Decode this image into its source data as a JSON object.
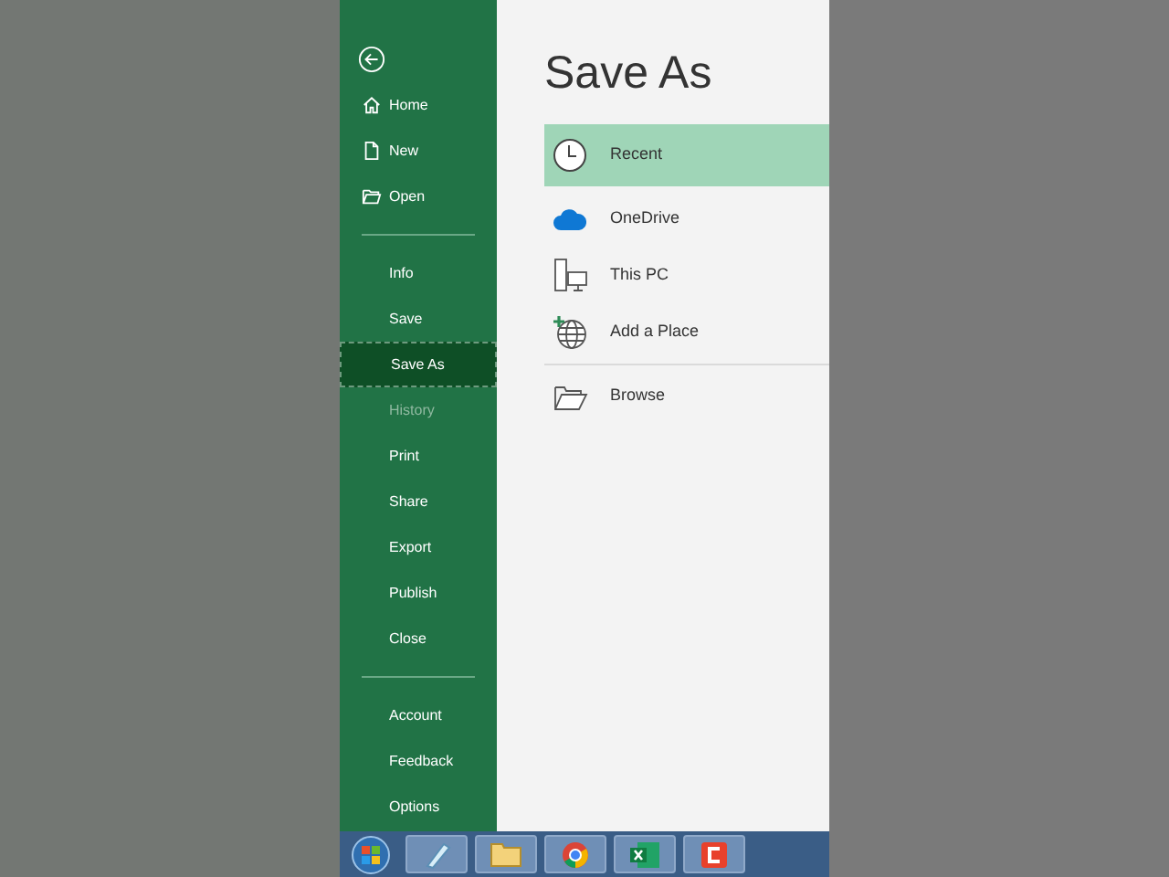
{
  "sidebar": {
    "groups": [
      {
        "items": [
          {
            "label": "Home",
            "selected": false,
            "disabled": false
          },
          {
            "label": "New",
            "selected": false,
            "disabled": false
          },
          {
            "label": "Open",
            "selected": false,
            "disabled": false
          }
        ]
      },
      {
        "items": [
          {
            "label": "Info",
            "selected": false,
            "disabled": false
          },
          {
            "label": "Save",
            "selected": false,
            "disabled": false
          },
          {
            "label": "Save As",
            "selected": true,
            "disabled": false
          },
          {
            "label": "History",
            "selected": false,
            "disabled": true
          },
          {
            "label": "Print",
            "selected": false,
            "disabled": false
          },
          {
            "label": "Share",
            "selected": false,
            "disabled": false
          },
          {
            "label": "Export",
            "selected": false,
            "disabled": false
          },
          {
            "label": "Publish",
            "selected": false,
            "disabled": false
          },
          {
            "label": "Close",
            "selected": false,
            "disabled": false
          }
        ]
      },
      {
        "items": [
          {
            "label": "Account",
            "selected": false,
            "disabled": false
          },
          {
            "label": "Feedback",
            "selected": false,
            "disabled": false
          },
          {
            "label": "Options",
            "selected": false,
            "disabled": false
          }
        ]
      }
    ]
  },
  "main": {
    "title": "Save As",
    "places": [
      {
        "label": "Recent",
        "selected": true
      },
      {
        "label": "OneDrive",
        "selected": false
      },
      {
        "label": "This PC",
        "selected": false
      },
      {
        "label": "Add a Place",
        "selected": false
      }
    ],
    "browse": {
      "label": "Browse"
    }
  }
}
